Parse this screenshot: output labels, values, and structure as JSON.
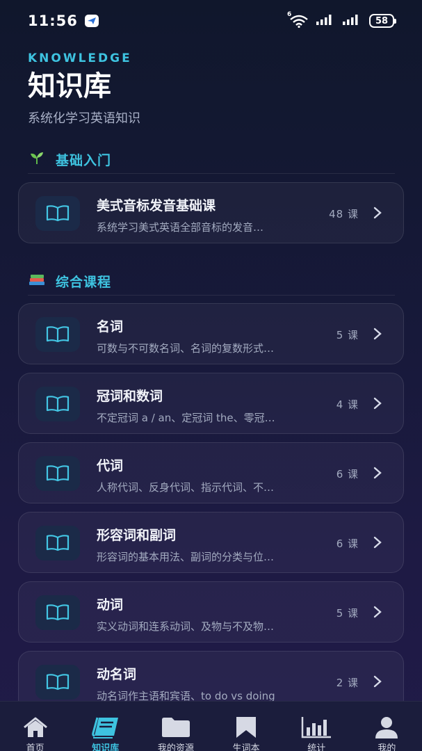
{
  "status_bar": {
    "time": "11:56",
    "battery": "58",
    "network_label": "6"
  },
  "header": {
    "eyebrow": "KNOWLEDGE",
    "title": "知识库",
    "subtitle": "系统化学习英语知识"
  },
  "sections": [
    {
      "title": "基础入门",
      "icon": "seedling-icon",
      "items": [
        {
          "title": "美式音标发音基础课",
          "desc": "系统学习美式英语全部音标的发音…",
          "count": "48 课"
        }
      ]
    },
    {
      "title": "综合课程",
      "icon": "books-icon",
      "items": [
        {
          "title": "名词",
          "desc": "可数与不可数名词、名词的复数形式…",
          "count": "5 课"
        },
        {
          "title": "冠词和数词",
          "desc": "不定冠词 a / an、定冠词 the、零冠…",
          "count": "4 课"
        },
        {
          "title": "代词",
          "desc": "人称代词、反身代词、指示代词、不…",
          "count": "6 课"
        },
        {
          "title": "形容词和副词",
          "desc": "形容词的基本用法、副词的分类与位…",
          "count": "6 课"
        },
        {
          "title": "动词",
          "desc": "实义动词和连系动词、及物与不及物…",
          "count": "5 课"
        },
        {
          "title": "动名词",
          "desc": "动名词作主语和宾语、to do vs doing",
          "count": "2 课"
        }
      ]
    }
  ],
  "tab_bar": {
    "active": "知识库",
    "items": [
      {
        "label": "首页",
        "icon": "home-icon"
      },
      {
        "label": "知识库",
        "icon": "book-icon"
      },
      {
        "label": "我的资源",
        "icon": "folder-icon"
      },
      {
        "label": "生词本",
        "icon": "bookmark-icon"
      },
      {
        "label": "统计",
        "icon": "bar-chart-icon"
      },
      {
        "label": "我的",
        "icon": "user-icon"
      }
    ]
  },
  "colors": {
    "accent": "#3ec3e0",
    "background_top": "#10172c",
    "background_bottom": "#201b48",
    "card_icon_bg": "#1b2a48"
  }
}
